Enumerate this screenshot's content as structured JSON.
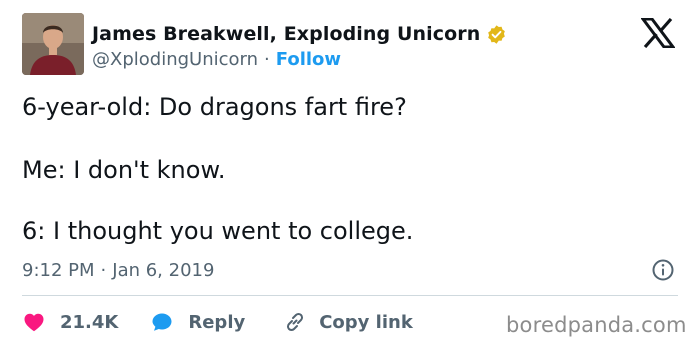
{
  "author": {
    "name": "James Breakwell, Exploding Unicorn",
    "handle": "@XplodingUnicorn",
    "separator": "·",
    "follow_label": "Follow",
    "verified_color": "#e2b719"
  },
  "tweet": {
    "lines": [
      "6-year-old: Do dragons fart fire?",
      "Me: I don't know.",
      "6: I thought you went to college."
    ],
    "time": "9:12 PM",
    "date": "Jan 6, 2019"
  },
  "actions": {
    "like_count": "21.4K",
    "reply_label": "Reply",
    "copy_link_label": "Copy link"
  },
  "watermark": "boredpanda.com",
  "colors": {
    "like": "#f91880",
    "reply": "#1d9bf0",
    "link": "#1d9bf0",
    "muted": "#536471"
  }
}
